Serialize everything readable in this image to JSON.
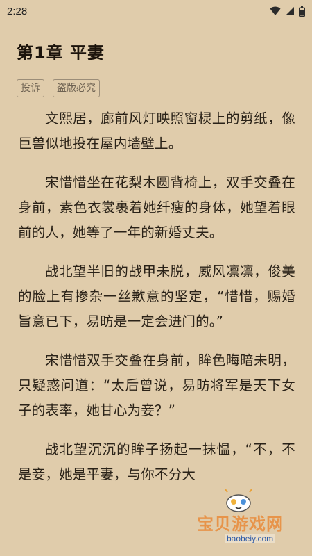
{
  "status": {
    "time": "2:28",
    "icons": [
      "wifi-icon",
      "cell-signal-icon",
      "battery-icon"
    ]
  },
  "chapter": {
    "title": "第1章 平妻"
  },
  "actions": {
    "report_label": "投诉",
    "piracy_label": "盗版必究"
  },
  "paragraphs": [
    "文熙居，廊前风灯映照窗棂上的剪纸，像巨兽似地投在屋内墙壁上。",
    "宋惜惜坐在花梨木圆背椅上，双手交叠在身前，素色衣裳裹着她纤瘦的身体，她望着眼前的人，她等了一年的新婚丈夫。",
    "战北望半旧的战甲未脱，威风凛凛，俊美的脸上有掺杂一丝歉意的坚定，“惜惜，赐婚旨意已下，易昉是一定会进门的。”",
    "宋惜惜双手交叠在身前，眸色晦暗未明，只疑惑问道：“太后曾说，易昉将军是天下女子的表率，她甘心为妾？”",
    "战北望沉沉的眸子扬起一抹愠，“不，不是妾，她是平妻，与你不分大"
  ],
  "watermark": {
    "brand": "宝贝游戏网",
    "url": "baobeiy.com"
  },
  "colors": {
    "background": "#e0ccab",
    "text": "#2a2218",
    "tag_border": "#9b8d78",
    "watermark_orange": "#e98b3a",
    "watermark_blue": "#2d5aa7"
  }
}
